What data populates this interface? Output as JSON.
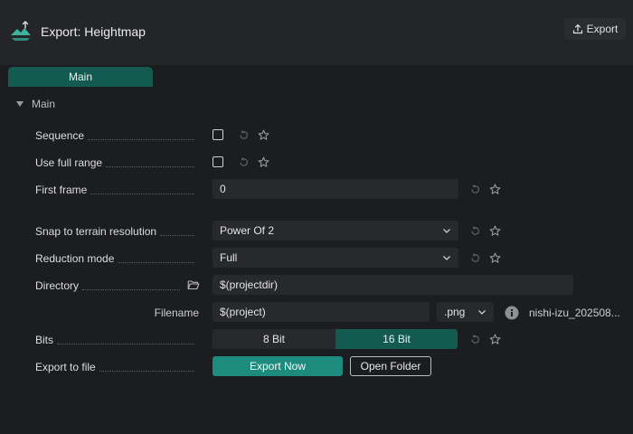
{
  "header": {
    "title": "Export: Heightmap",
    "export_button_label": "Export",
    "logo_icon": "terrain-logo-icon"
  },
  "tabs": [
    {
      "label": "Main",
      "active": true
    }
  ],
  "section": {
    "title": "Main",
    "expanded": true
  },
  "rows": {
    "sequence": {
      "label": "Sequence",
      "checked": false
    },
    "use_full_range": {
      "label": "Use full range",
      "checked": false
    },
    "first_frame": {
      "label": "First frame",
      "value": "0"
    },
    "snap": {
      "label": "Snap to terrain resolution",
      "value": "Power Of 2"
    },
    "reduction_mode": {
      "label": "Reduction mode",
      "value": "Full"
    },
    "directory": {
      "label": "Directory",
      "value": "$(projectdir)"
    },
    "filename": {
      "label": "Filename",
      "value": "$(project)",
      "extension": ".png",
      "preview": "nishi-izu_202508..."
    },
    "bits": {
      "label": "Bits",
      "options": [
        "8 Bit",
        "16 Bit"
      ],
      "selected": "16 Bit"
    },
    "export_to_file": {
      "label": "Export to file",
      "export_now_label": "Export Now",
      "open_folder_label": "Open Folder"
    }
  },
  "colors": {
    "accent": "#1d8c7e",
    "accent_dark": "#135a50",
    "background": "#1b1d20",
    "field": "#27292c"
  }
}
